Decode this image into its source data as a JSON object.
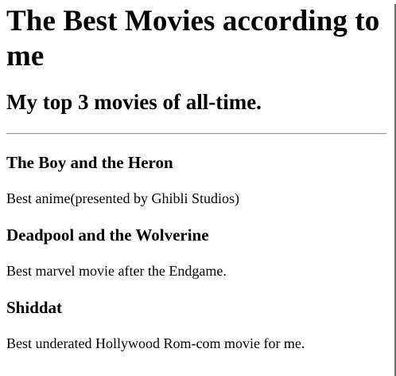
{
  "page": {
    "title": "The Best Movies according to me",
    "subtitle": "My top 3 movies of all-time."
  },
  "movies": [
    {
      "title": "The Boy and the Heron",
      "description": "Best anime(presented by Ghibli Studios)"
    },
    {
      "title": "Deadpool and the Wolverine",
      "description": "Best marvel movie after the Endgame."
    },
    {
      "title": "Shiddat",
      "description": "Best underated Hollywood Rom-com movie for me."
    }
  ]
}
